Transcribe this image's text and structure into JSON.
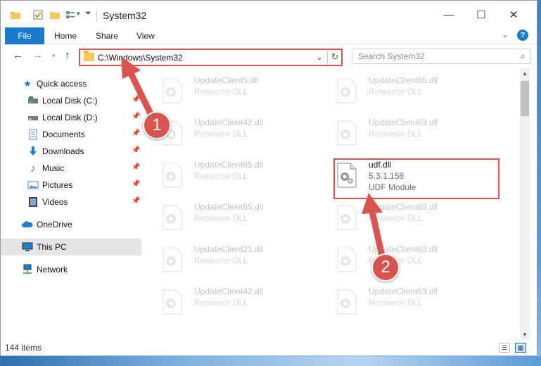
{
  "window": {
    "title": "System32",
    "controls": {
      "minimize": "—",
      "maximize": "☐",
      "close": "✕"
    }
  },
  "ribbon": {
    "file": "File",
    "home": "Home",
    "share": "Share",
    "view": "View",
    "help": "?"
  },
  "address": {
    "path": "C:\\Windows\\System32",
    "search_placeholder": "Search System32"
  },
  "sidebar": {
    "quick_access": "Quick access",
    "items": [
      {
        "label": "Local Disk (C:)",
        "icon": "local-disk-icon",
        "pinned": true
      },
      {
        "label": "Local Disk (D:)",
        "icon": "local-disk-icon",
        "pinned": true
      },
      {
        "label": "Documents",
        "icon": "documents-icon",
        "pinned": true
      },
      {
        "label": "Downloads",
        "icon": "downloads-icon",
        "pinned": true
      },
      {
        "label": "Music",
        "icon": "music-icon",
        "pinned": true
      },
      {
        "label": "Pictures",
        "icon": "pictures-icon",
        "pinned": true
      },
      {
        "label": "Videos",
        "icon": "videos-icon",
        "pinned": true
      }
    ],
    "onedrive": "OneDrive",
    "this_pc": "This PC",
    "network": "Network"
  },
  "files": {
    "left": [
      {
        "name": "UpdateClient5.dll",
        "type": "Resource DLL"
      },
      {
        "name": "UpdateClient42.dll",
        "type": "Resource DLL"
      },
      {
        "name": "UpdateClient65.dll",
        "type": "Resource DLL"
      },
      {
        "name": "UpdateClient65.dll",
        "type": "Resource DLL"
      },
      {
        "name": "UpdateClient21.dll",
        "type": "Resource DLL"
      },
      {
        "name": "UpdateClient42.dll",
        "type": "Resource DLL"
      }
    ],
    "right": [
      {
        "name": "UpdateClient65.dll",
        "type": "Resource DLL"
      },
      {
        "name": "UpdateClient63.dll",
        "type": "Resource DLL"
      },
      {
        "name": "udf.dll",
        "version": "5.3.1.158",
        "type": "UDF Module"
      },
      {
        "name": "UpdateClient65.dll",
        "type": "Resource DLL"
      },
      {
        "name": "UpdateClient63.dll",
        "type": "Resource DLL"
      },
      {
        "name": "UpdateClient63.dll",
        "type": "Resource DLL"
      }
    ]
  },
  "status": {
    "items": "144 items"
  },
  "annotations": {
    "step1": "1",
    "step2": "2",
    "color": "#d9534f"
  }
}
